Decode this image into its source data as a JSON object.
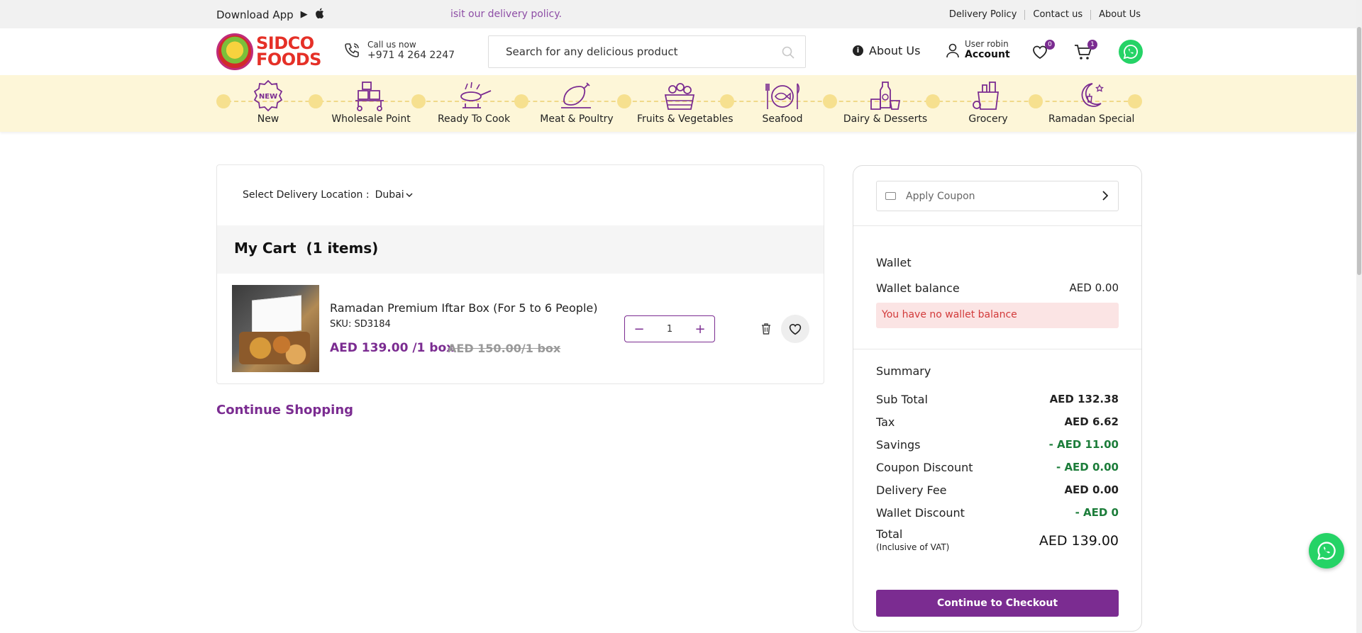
{
  "topbar": {
    "download_app": "Download App",
    "marquee": "isit our delivery policy.",
    "links": [
      "Delivery Policy",
      "Contact us",
      "About Us"
    ]
  },
  "header": {
    "logo": "SIDCO FOODS",
    "logo_line1": "SIDCO",
    "logo_line2": "FOODS",
    "call_label": "Call us now",
    "call_number": "+971 4 264 2247",
    "search_placeholder": "Search for any delicious product",
    "about": "About Us",
    "account_user": "User robin",
    "account_label": "Account",
    "wishlist_count": "0",
    "cart_count": "1"
  },
  "categories": [
    {
      "label": "New",
      "icon": "new-badge-icon"
    },
    {
      "label": "Wholesale Point",
      "icon": "boxes-cart-icon"
    },
    {
      "label": "Ready To Cook",
      "icon": "cooking-pan-icon"
    },
    {
      "label": "Meat & Poultry",
      "icon": "chicken-leg-icon"
    },
    {
      "label": "Fruits & Vegetables",
      "icon": "fruit-basket-icon"
    },
    {
      "label": "Seafood",
      "icon": "fish-plate-icon"
    },
    {
      "label": "Dairy & Desserts",
      "icon": "dairy-icon"
    },
    {
      "label": "Grocery",
      "icon": "grocery-bag-icon"
    },
    {
      "label": "Ramadan Special",
      "icon": "crescent-lantern-icon"
    }
  ],
  "cart": {
    "location_label": "Select Delivery Location :",
    "location_value": "Dubai",
    "title": "My Cart",
    "count_text": "(1 items)",
    "items": [
      {
        "name": "Ramadan Premium Iftar Box (For 5 to 6 People)",
        "sku": "SKU: SD3184",
        "price": "AED 139.00 /1 box",
        "old_price": "AED 150.00/1 box",
        "quantity": "1"
      }
    ],
    "continue_shopping": "Continue Shopping"
  },
  "summary": {
    "coupon_placeholder": "Apply Coupon",
    "wallet_title": "Wallet",
    "wallet_balance_label": "Wallet balance",
    "wallet_balance_value": "AED 0.00",
    "wallet_alert": "You have no wallet balance",
    "summary_title": "Summary",
    "rows": [
      {
        "label": "Sub Total",
        "value": "AED 132.38"
      },
      {
        "label": "Tax",
        "value": "AED 6.62"
      },
      {
        "label": "Savings",
        "value": "- AED 11.00"
      },
      {
        "label": "Coupon Discount",
        "value": "- AED 0.00"
      },
      {
        "label": "Delivery Fee",
        "value": "AED 0.00"
      },
      {
        "label": "Wallet Discount",
        "value": "- AED 0"
      }
    ],
    "total_label": "Total",
    "total_note": "(Inclusive of VAT)",
    "total_value": "AED 139.00",
    "checkout_label": "Continue to Checkout"
  },
  "colors": {
    "brand_purple": "#7b2c91",
    "nav_bg": "#fdf6d8",
    "savings_green": "#1c7d3a",
    "alert_red": "#d23a3a",
    "whatsapp_green": "#25d366"
  }
}
